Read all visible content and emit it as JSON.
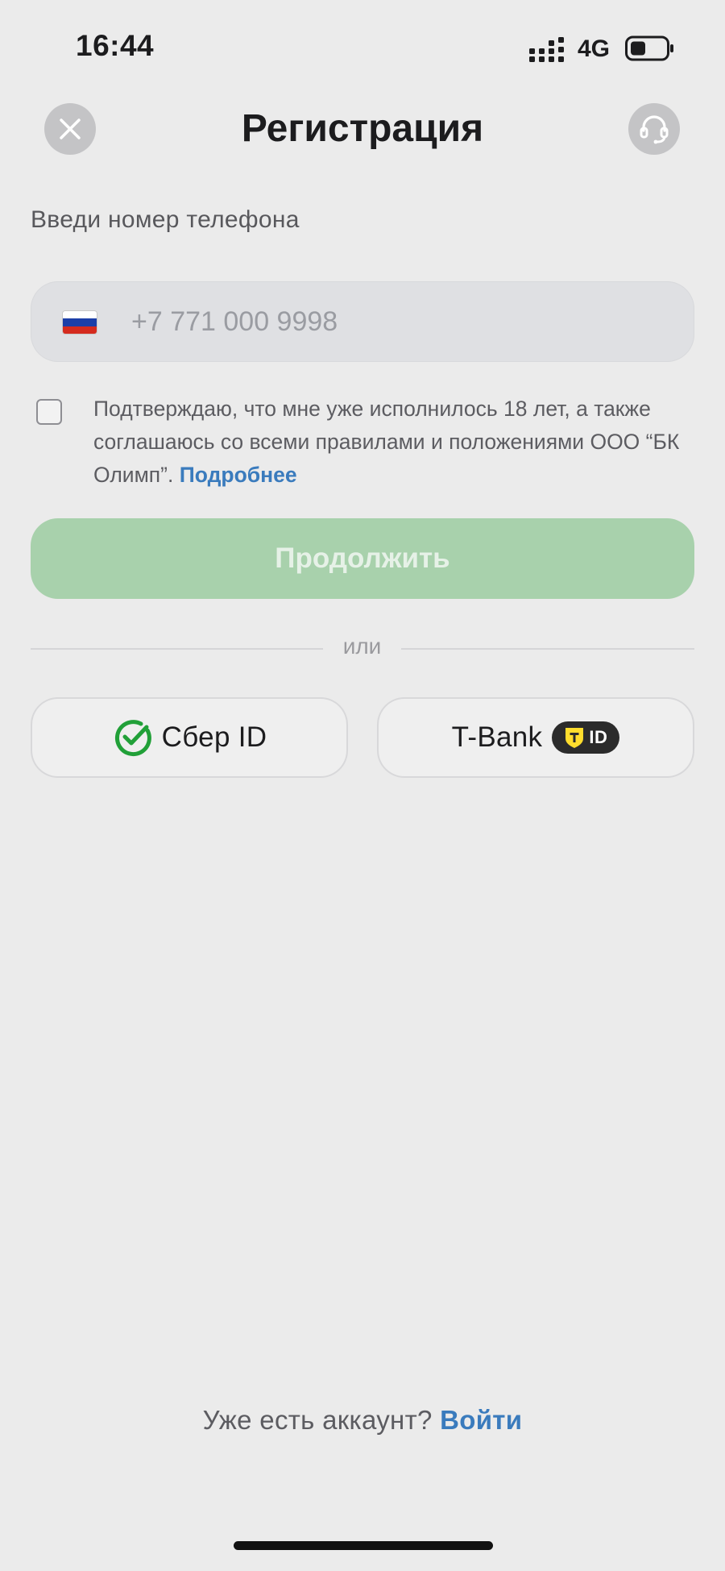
{
  "status_bar": {
    "time": "16:44",
    "network": "4G",
    "icons": [
      "signal-icon",
      "battery-icon"
    ]
  },
  "header": {
    "title": "Регистрация",
    "left_icon": "close-icon",
    "right_icon": "headset-support-icon"
  },
  "phone": {
    "label": "Введи номер телефона",
    "placeholder": "+7 771 000 9998",
    "value": "",
    "country_flag": "russia-flag-icon"
  },
  "consent": {
    "text": "Подтверждаю, что мне уже исполнилось 18 лет, а также соглашаюсь со всеми правилами и положениями ООО “БК Олимп”.",
    "link": "Подробнее",
    "checked": false
  },
  "continue_button": {
    "label": "Продолжить",
    "enabled": false
  },
  "divider": {
    "label": "или"
  },
  "id_providers": [
    {
      "label": "Сбер ID",
      "icon": "sber-check-icon"
    },
    {
      "label": "T-Bank",
      "badge": "ID",
      "icon": "tbank-shield-icon"
    }
  ],
  "footer": {
    "prompt": "Уже есть аккаунт?",
    "link": "Войти"
  },
  "colors": {
    "background": "#ebebeb",
    "accent_link": "#3a7bbd",
    "continue_disabled": "#a8d1ac",
    "sber_green": "#21a038",
    "tbank_yellow": "#ffdd2d",
    "field_background": "#dfe0e3"
  }
}
